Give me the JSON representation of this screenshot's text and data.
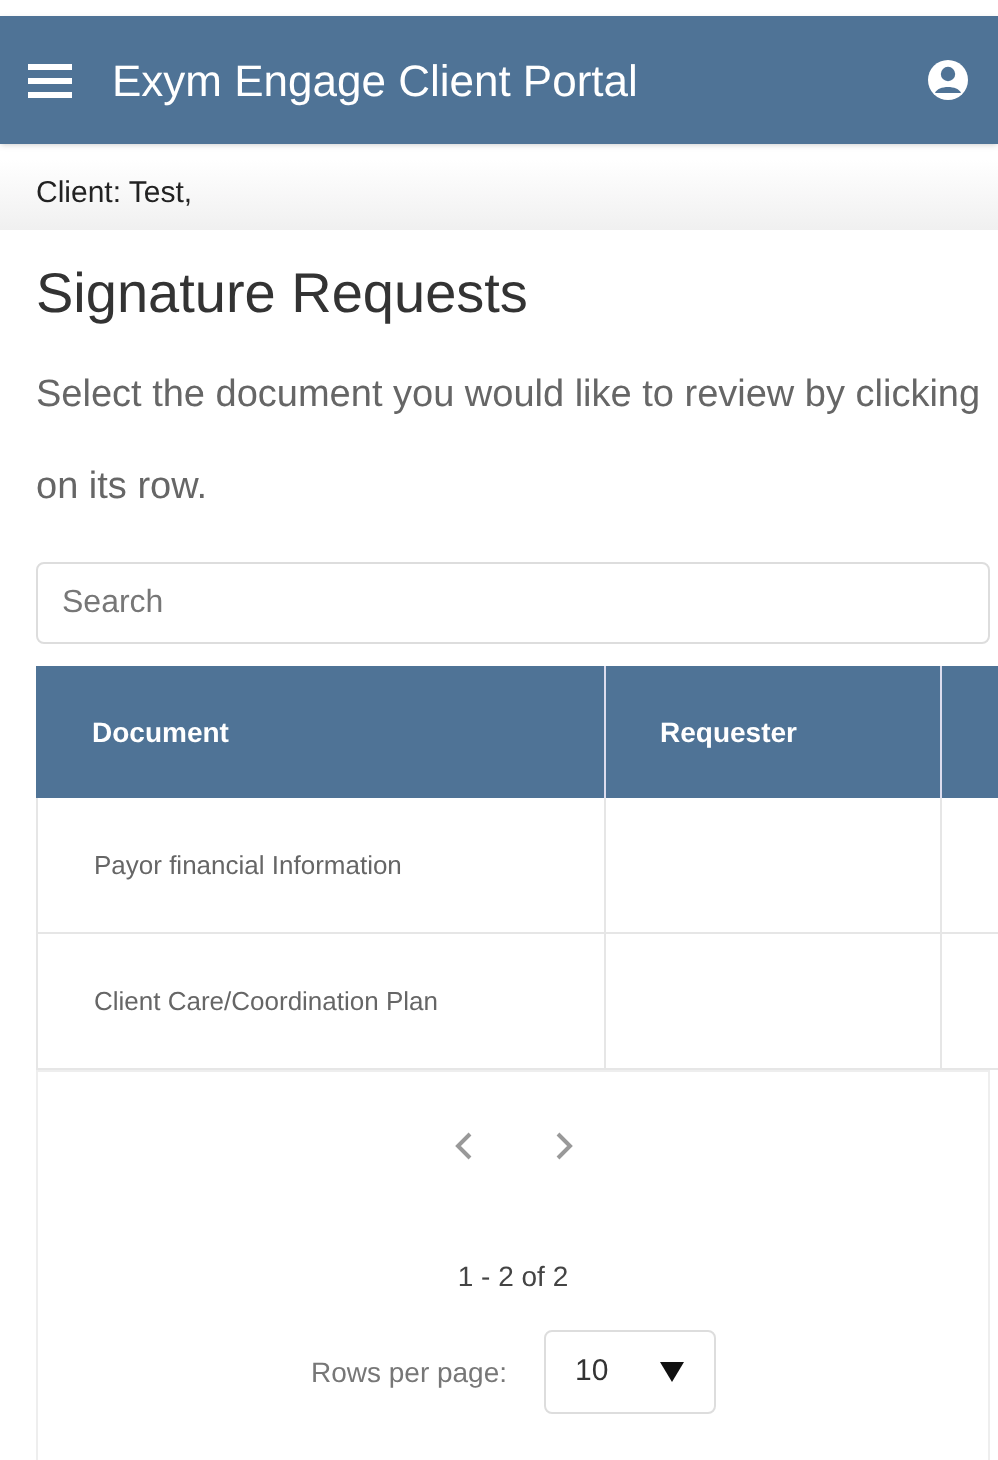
{
  "app_bar": {
    "title": "Exym Engage Client Portal"
  },
  "client_bar": {
    "text": "Client: Test,"
  },
  "page": {
    "title": "Signature Requests",
    "instructions": "Select the document you would like to review by clicking on its row."
  },
  "search": {
    "placeholder": "Search"
  },
  "table": {
    "columns": [
      "Document",
      "Requester"
    ],
    "rows": [
      {
        "document": "Payor financial Information"
      },
      {
        "document": "Client Care/Coordination Plan"
      }
    ]
  },
  "pagination": {
    "range": "1 - 2 of 2",
    "rows_per_page_label": "Rows per page:",
    "rows_per_page": "10"
  }
}
